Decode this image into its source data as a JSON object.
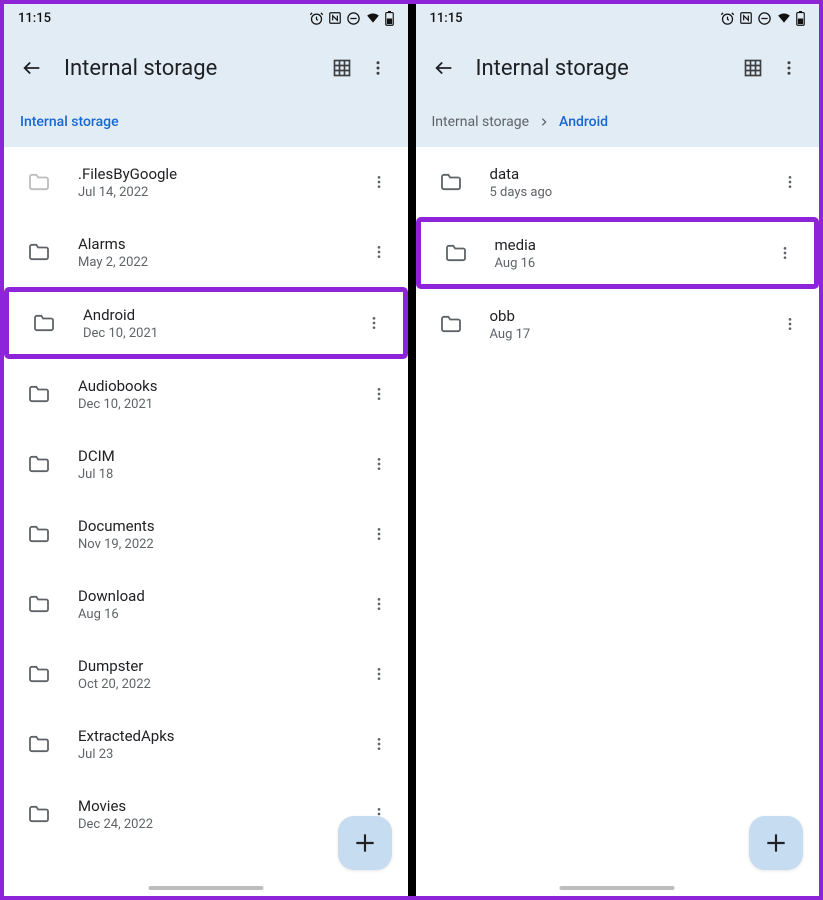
{
  "status": {
    "time": "11:15"
  },
  "appbar": {
    "title": "Internal storage"
  },
  "left": {
    "breadcrumb": [
      {
        "label": "Internal storage",
        "current": true
      }
    ],
    "highlight_index": 2,
    "items": [
      {
        "name": ".FilesByGoogle",
        "date": "Jul 14, 2022",
        "faded": true
      },
      {
        "name": "Alarms",
        "date": "May 2, 2022"
      },
      {
        "name": "Android",
        "date": "Dec 10, 2021"
      },
      {
        "name": "Audiobooks",
        "date": "Dec 10, 2021"
      },
      {
        "name": "DCIM",
        "date": "Jul 18"
      },
      {
        "name": "Documents",
        "date": "Nov 19, 2022"
      },
      {
        "name": "Download",
        "date": "Aug 16"
      },
      {
        "name": "Dumpster",
        "date": "Oct 20, 2022"
      },
      {
        "name": "ExtractedApks",
        "date": "Jul 23"
      },
      {
        "name": "Movies",
        "date": "Dec 24, 2022"
      }
    ]
  },
  "right": {
    "breadcrumb": [
      {
        "label": "Internal storage",
        "current": false
      },
      {
        "label": "Android",
        "current": true
      }
    ],
    "highlight_index": 1,
    "items": [
      {
        "name": "data",
        "date": "5 days ago"
      },
      {
        "name": "media",
        "date": "Aug 16"
      },
      {
        "name": "obb",
        "date": "Aug 17"
      }
    ]
  }
}
